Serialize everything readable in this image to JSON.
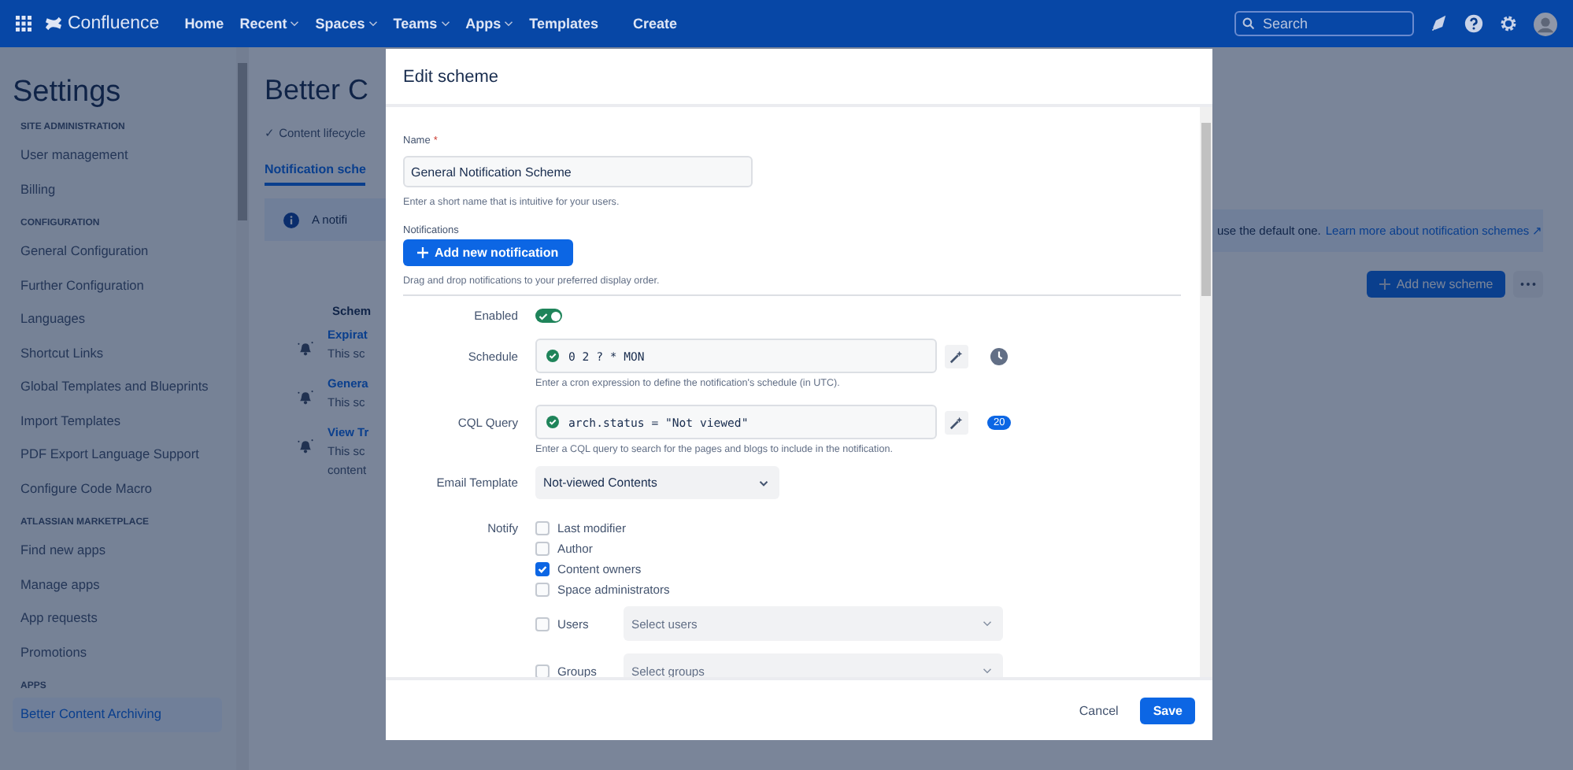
{
  "topnav": {
    "product": "Confluence",
    "items": [
      {
        "label": "Home",
        "dropdown": false
      },
      {
        "label": "Recent",
        "dropdown": true
      },
      {
        "label": "Spaces",
        "dropdown": true
      },
      {
        "label": "Teams",
        "dropdown": true
      },
      {
        "label": "Apps",
        "dropdown": true
      },
      {
        "label": "Templates",
        "dropdown": false
      }
    ],
    "create": "Create",
    "search": {
      "placeholder": "Search"
    }
  },
  "sidebar": {
    "title": "Settings",
    "sections": [
      {
        "heading": "SITE ADMINISTRATION",
        "items": [
          {
            "label": "User management",
            "selected": false
          },
          {
            "label": "Billing",
            "selected": false
          }
        ]
      },
      {
        "heading": "CONFIGURATION",
        "items": [
          {
            "label": "General Configuration",
            "selected": false
          },
          {
            "label": "Further Configuration",
            "selected": false
          },
          {
            "label": "Languages",
            "selected": false
          },
          {
            "label": "Shortcut Links",
            "selected": false
          },
          {
            "label": "Global Templates and Blueprints",
            "selected": false
          },
          {
            "label": "Import Templates",
            "selected": false
          },
          {
            "label": "PDF Export Language Support",
            "selected": false
          },
          {
            "label": "Configure Code Macro",
            "selected": false
          }
        ]
      },
      {
        "heading": "ATLASSIAN MARKETPLACE",
        "items": [
          {
            "label": "Find new apps",
            "selected": false
          },
          {
            "label": "Manage apps",
            "selected": false
          },
          {
            "label": "App requests",
            "selected": false
          },
          {
            "label": "Promotions",
            "selected": false
          }
        ]
      },
      {
        "heading": "APPS",
        "items": [
          {
            "label": "Better Content Archiving",
            "selected": true
          }
        ]
      }
    ]
  },
  "page": {
    "title": "Better C",
    "breadcrumb": "✓ Content lifecycle",
    "tab": "Notification sche",
    "banner": {
      "text_start": "A notifi",
      "text_end": "use the default one.",
      "link": "Learn more about notification schemes ↗"
    },
    "add_button": "Add new scheme",
    "schemes_heading": "Schem",
    "schemes": [
      {
        "name": "Expirat",
        "description": [
          "This sc"
        ]
      },
      {
        "name": "Genera",
        "description": [
          "This sc"
        ]
      },
      {
        "name": "View Tr",
        "description": [
          "This sc",
          "content"
        ]
      }
    ]
  },
  "modal": {
    "title": "Edit scheme",
    "name": {
      "label": "Name",
      "required_mark": "*",
      "value": "General Notification Scheme",
      "help": "Enter a short name that is intuitive for your users."
    },
    "notifications": {
      "label": "Notifications",
      "add_button": "Add new notification",
      "help": "Drag and drop notifications to your preferred display order."
    },
    "enabled": {
      "label": "Enabled",
      "on": true
    },
    "schedule": {
      "label": "Schedule",
      "value": "0 2 ? * MON",
      "valid": true,
      "help": "Enter a cron expression to define the notification's schedule (in UTC)."
    },
    "cql": {
      "label": "CQL Query",
      "value": "arch.status = \"Not viewed\"",
      "valid": true,
      "count": "20",
      "help": "Enter a CQL query to search for the pages and blogs to include in the notification."
    },
    "email_template": {
      "label": "Email Template",
      "value": "Not-viewed Contents"
    },
    "notify": {
      "label": "Notify",
      "options": [
        {
          "kind": "checkbox",
          "label": "Last modifier",
          "checked": false
        },
        {
          "kind": "checkbox",
          "label": "Author",
          "checked": false
        },
        {
          "kind": "checkbox",
          "label": "Content owners",
          "checked": true
        },
        {
          "kind": "checkbox",
          "label": "Space administrators",
          "checked": false
        },
        {
          "kind": "select",
          "label": "Users",
          "checked": false,
          "placeholder": "Select users"
        },
        {
          "kind": "select",
          "label": "Groups",
          "checked": false,
          "placeholder": "Select groups"
        }
      ]
    },
    "cancel": "Cancel",
    "save": "Save"
  }
}
